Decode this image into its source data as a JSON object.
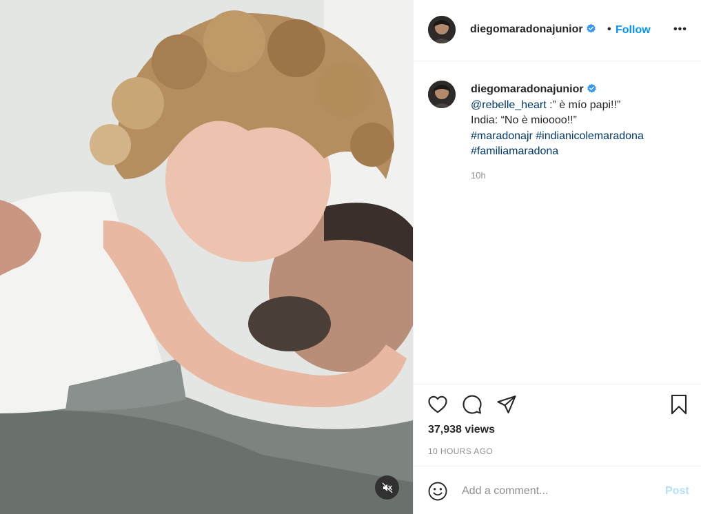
{
  "post": {
    "username": "diegomaradonajunior",
    "follow_separator": "•",
    "follow_label": "Follow",
    "more_label": "•••"
  },
  "caption": {
    "username": "diegomaradonajunior",
    "mention": "@rebelle_heart",
    "line1_rest": " :” è mío papi!!”",
    "line2": "India: “No è mioooo!!”",
    "hashtags": [
      "#maradonajr",
      "#indianicolemaradona",
      "#familiamaradona"
    ],
    "time": "10h"
  },
  "stats": {
    "views": "37,938 views",
    "posted": "10 HOURS AGO"
  },
  "comment": {
    "placeholder": "Add a comment...",
    "post_label": "Post"
  },
  "icons": {
    "verified": "verified-badge-icon",
    "like": "heart-icon",
    "comment": "comment-bubble-icon",
    "share": "paper-plane-icon",
    "save": "bookmark-icon",
    "mute": "speaker-muted-icon",
    "emoji": "smiley-icon"
  },
  "colors": {
    "link": "#00376b",
    "follow": "#0095f6",
    "verified": "#3897f0",
    "muted_text": "#8e8e8e",
    "post_disabled": "#b2dffc"
  }
}
